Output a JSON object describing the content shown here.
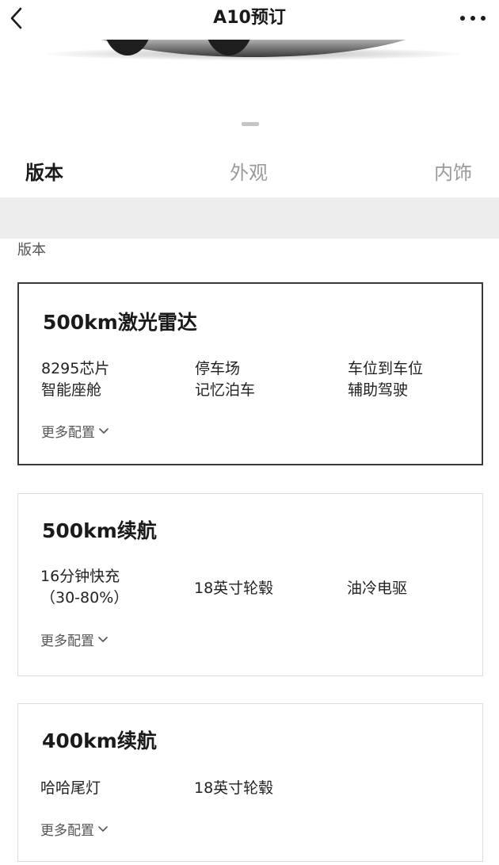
{
  "header": {
    "title": "A10预订"
  },
  "tabs": [
    {
      "label": "版本",
      "active": true
    },
    {
      "label": "外观",
      "active": false
    },
    {
      "label": "内饰",
      "active": false
    }
  ],
  "section": {
    "label": "版本"
  },
  "cards": [
    {
      "title": "500km激光雷达",
      "selected": true,
      "features": [
        [
          "8295芯片",
          "智能座舱"
        ],
        [
          "停车场",
          "记忆泊车"
        ],
        [
          "车位到车位",
          "辅助驾驶"
        ]
      ],
      "more_label": "更多配置"
    },
    {
      "title": "500km续航",
      "selected": false,
      "features": [
        [
          "16分钟快充",
          "（30-80%）"
        ],
        [
          "18英寸轮毂"
        ],
        [
          "油冷电驱"
        ]
      ],
      "more_label": "更多配置"
    },
    {
      "title": "400km续航",
      "selected": false,
      "features": [
        [
          "哈哈尾灯"
        ],
        [
          "18英寸轮毂"
        ]
      ],
      "more_label": "更多配置"
    }
  ],
  "icons": {
    "back": "chevron-left-icon",
    "more": "more-dots-icon",
    "expand": "chevron-down-icon"
  },
  "colors": {
    "selected_border": "#3a3a3a",
    "card_border": "#dcdcdc",
    "band": "#ededed"
  }
}
